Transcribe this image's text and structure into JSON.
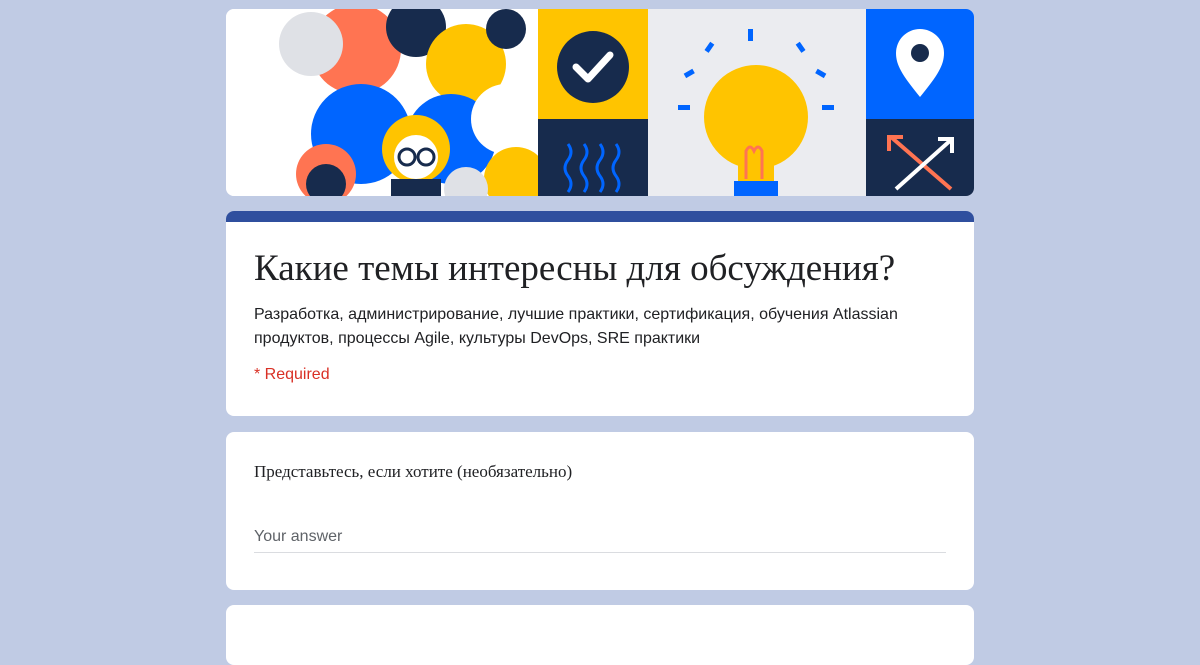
{
  "form": {
    "title": "Какие темы интересны для обсуждения?",
    "description": "Разработка, администрирование, лучшие практики, сертификация, обучения Atlassian продуктов, процессы Agile, культуры DevOps, SRE практики",
    "required_note": "* Required"
  },
  "questions": [
    {
      "label": "Представьтесь, если хотите (необязательно)",
      "placeholder": "Your answer",
      "value": ""
    }
  ],
  "banner": {
    "icons": [
      "people-illustration",
      "check-icon",
      "waves-pattern",
      "lightbulb-icon",
      "map-pin-icon",
      "arrows-icon"
    ]
  },
  "colors": {
    "page_bg": "#c0cbe4",
    "accent": "#2f4f9e",
    "required": "#d93025",
    "banner_yellow": "#ffc400",
    "banner_blue": "#0065ff",
    "banner_navy": "#172b4d",
    "banner_orange": "#ff7452"
  }
}
